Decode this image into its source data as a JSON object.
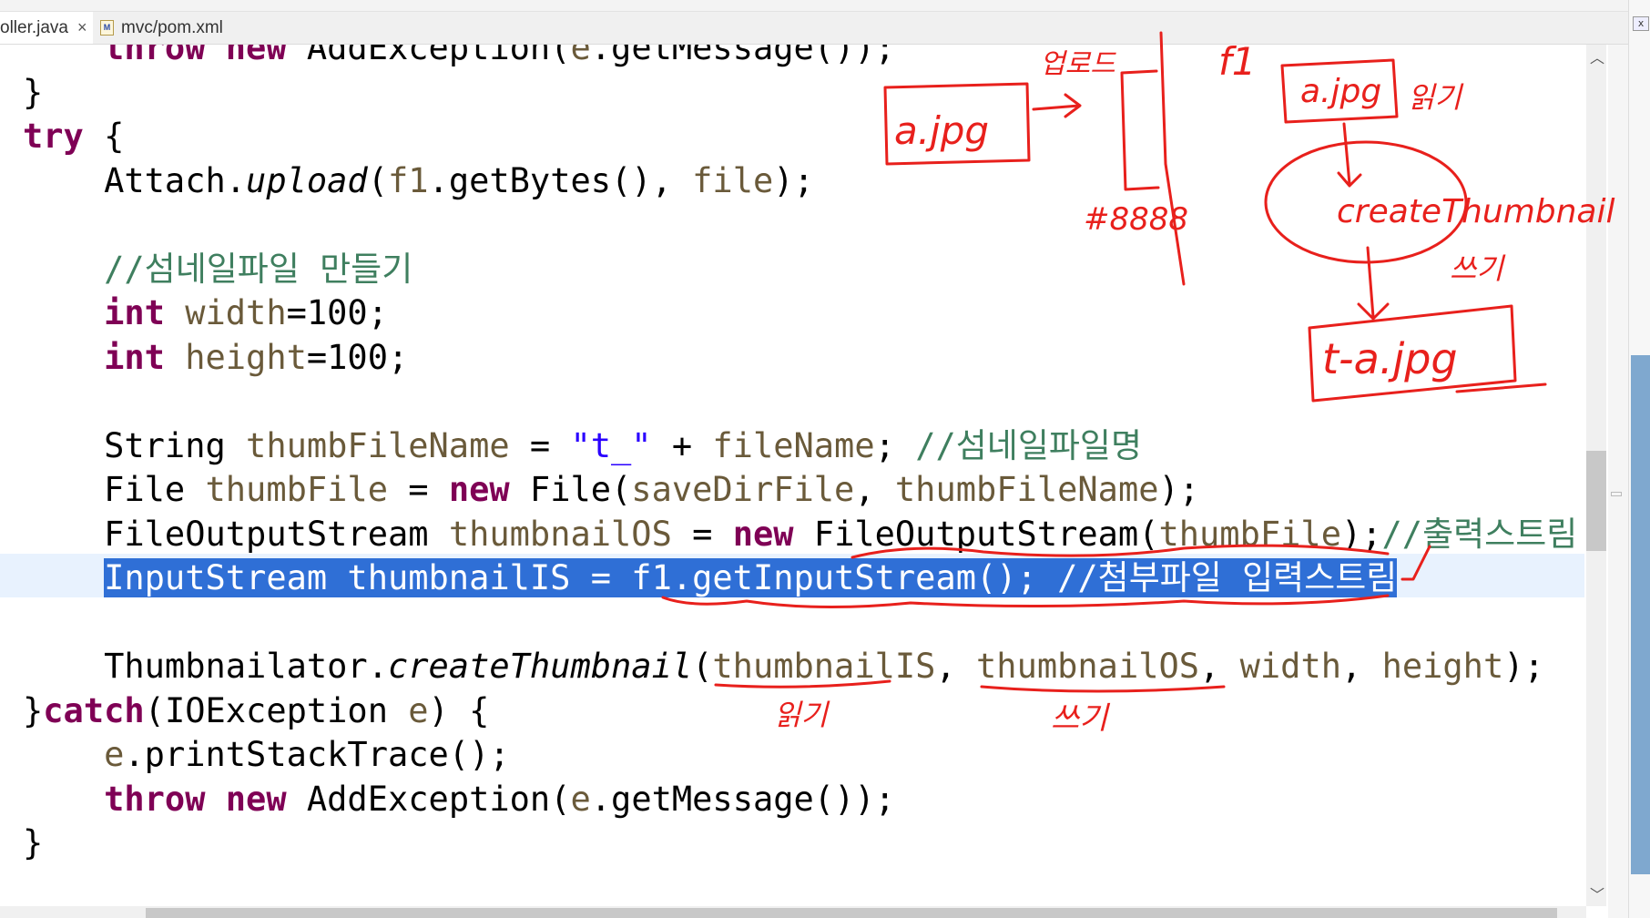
{
  "tabs": [
    {
      "label": "oller.java",
      "active": true,
      "close": "×"
    },
    {
      "label": "mvc/pom.xml",
      "icon": "maven-file-icon",
      "icon_text": "M"
    }
  ],
  "colors": {
    "keyword": "#7f0055",
    "comment": "#3f7f5f",
    "string": "#2a00ff",
    "selection": "#2f6fd6",
    "ink": "#e8201c"
  },
  "code": {
    "l0": {
      "kw": "throw",
      "kw2": "new",
      "rest": " AddException(",
      "v": "e",
      "end": ".getMessage());"
    },
    "l1": "}",
    "l2": {
      "kw": "try",
      "rest": " {"
    },
    "l3": {
      "a": "Attach.",
      "m": "upload",
      "b": "(",
      "v1": "f1",
      "c": ".getBytes(), ",
      "v2": "file",
      "d": ");"
    },
    "l5": "//섬네일파일 만들기",
    "l6": {
      "kw": "int",
      "v": "width",
      "rest": "=100;"
    },
    "l7": {
      "kw": "int",
      "v": "height",
      "rest": "=100;"
    },
    "l9": {
      "a": "String ",
      "v": "thumbFileName",
      "b": " = ",
      "s": "\"t_\"",
      "c": " + ",
      "v2": "fileName",
      "d": "; ",
      "cm": "//섬네일파일명"
    },
    "l10": {
      "a": "File ",
      "v": "thumbFile",
      "b": " = ",
      "kw": "new",
      "c": " File(",
      "v2": "saveDirFile",
      "d": ", ",
      "v3": "thumbFileName",
      "e": ");"
    },
    "l11": {
      "a": "FileOutputStream ",
      "v": "thumbnailOS",
      "b": " = ",
      "kw": "new",
      "c": " FileOutputStream(",
      "v2": "thumbFile",
      "d": ");",
      "cm": "//출력스트림"
    },
    "l12": {
      "a": "InputStream ",
      "v": "thumbnailIS",
      "b": " = ",
      "v2": "f1",
      "c": ".getInputStream(); ",
      "cm": "//첨부파일 입력스트림"
    },
    "l14": {
      "a": "Thumbnailator.",
      "m": "createThumbnail",
      "b": "(",
      "v1": "thumbnailIS",
      "c": ", ",
      "v2": "thumbnailOS",
      "d": ", ",
      "v3": "width",
      "e": ", ",
      "v4": "height",
      "f": ");"
    },
    "l15": {
      "a": "}",
      "kw": "catch",
      "b": "(IOException ",
      "v": "e",
      "c": ") {"
    },
    "l16": {
      "v": "e",
      "rest": ".printStackTrace();"
    },
    "l17": {
      "kw": "throw",
      "kw2": "new",
      "rest": " AddException(",
      "v": "e",
      "end": ".getMessage());"
    },
    "l18": "}"
  },
  "annotations": {
    "upload": "업로드",
    "file_a": "a.jpg",
    "port": "#8888",
    "f1": "f1",
    "file_a2": "a.jpg",
    "read": "읽기",
    "create": "createThumbnail",
    "write": "쓰기",
    "file_t": "t-a.jpg",
    "read2": "읽기",
    "write2": "쓰기"
  }
}
